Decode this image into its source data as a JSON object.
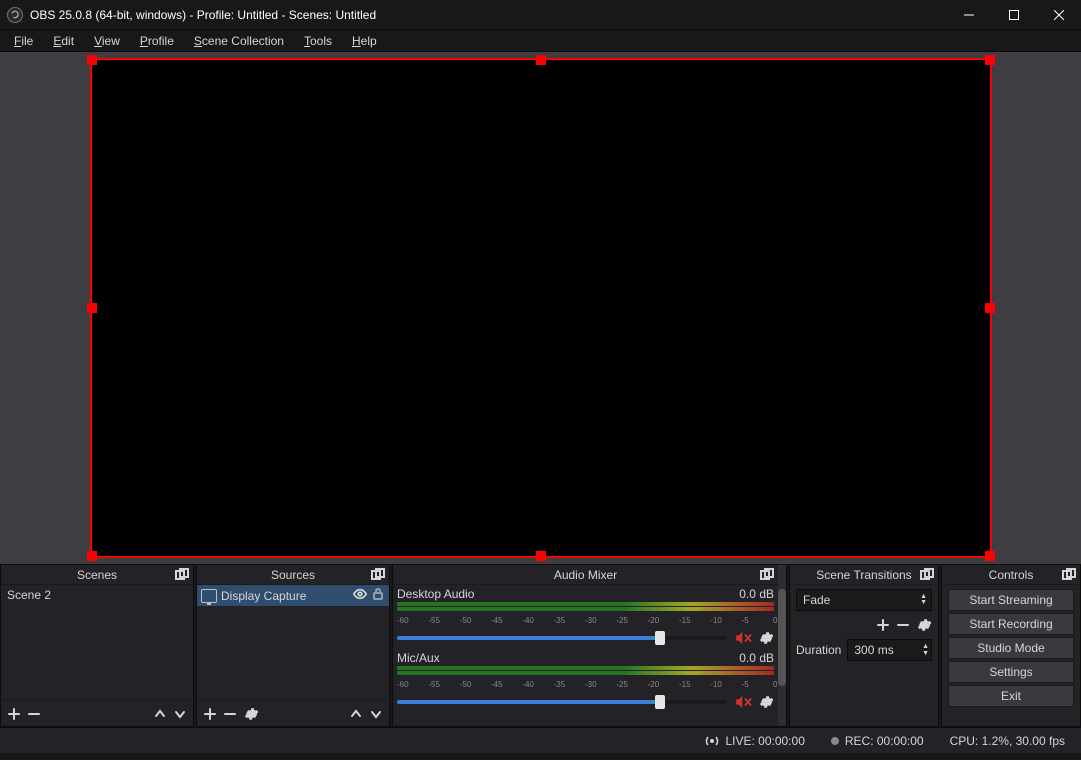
{
  "window": {
    "title": "OBS 25.0.8 (64-bit, windows) - Profile: Untitled - Scenes: Untitled"
  },
  "menu": {
    "file": "File",
    "edit": "Edit",
    "view": "View",
    "profile": "Profile",
    "scene_collection": "Scene Collection",
    "tools": "Tools",
    "help": "Help"
  },
  "docks": {
    "scenes": {
      "title": "Scenes",
      "items": [
        "Scene 2"
      ]
    },
    "sources": {
      "title": "Sources",
      "items": [
        {
          "name": "Display Capture"
        }
      ]
    },
    "mixer": {
      "title": "Audio Mixer",
      "channels": [
        {
          "name": "Desktop Audio",
          "db": "0.0 dB"
        },
        {
          "name": "Mic/Aux",
          "db": "0.0 dB"
        }
      ],
      "ticks": [
        "-60",
        "-55",
        "-50",
        "-45",
        "-40",
        "-35",
        "-30",
        "-25",
        "-20",
        "-15",
        "-10",
        "-5",
        "0"
      ]
    },
    "transitions": {
      "title": "Scene Transitions",
      "selected": "Fade",
      "duration_label": "Duration",
      "duration_value": "300 ms"
    },
    "controls": {
      "title": "Controls",
      "buttons": {
        "stream": "Start Streaming",
        "record": "Start Recording",
        "studio": "Studio Mode",
        "settings": "Settings",
        "exit": "Exit"
      }
    }
  },
  "status": {
    "live": "LIVE: 00:00:00",
    "rec": "REC: 00:00:00",
    "cpu": "CPU: 1.2%, 30.00 fps"
  }
}
